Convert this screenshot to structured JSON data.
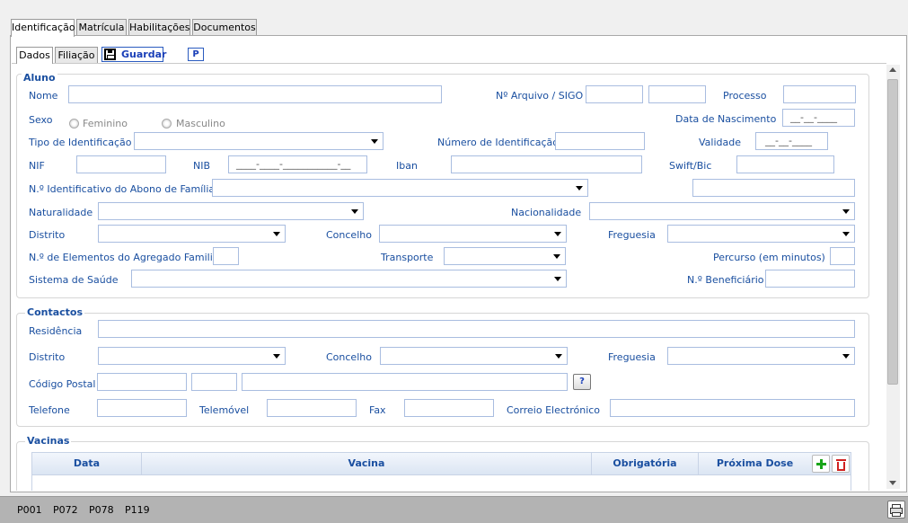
{
  "tabs": [
    "Identificação",
    "Matrícula",
    "Habilitações",
    "Documentos"
  ],
  "subtabs": [
    "Dados",
    "Filiação"
  ],
  "toolbar": {
    "save_label": "Guardar",
    "p_label": "P"
  },
  "aluno": {
    "legend": "Aluno",
    "nome": "Nome",
    "arquivo": "Nº Arquivo / SIGO",
    "processo": "Processo",
    "sexo": "Sexo",
    "feminino": "Feminino",
    "masculino": "Masculino",
    "data_nascimento": "Data de Nascimento",
    "data_nascimento_mask": "__-__-____",
    "tipo_identificacao": "Tipo de Identificação",
    "numero_identificacao": "Número de Identificação",
    "validade": "Validade",
    "validade_mask": "__-__-____",
    "nif": "NIF",
    "nib": "NIB",
    "nib_mask": "____-____-___________-__",
    "iban": "Iban",
    "swift": "Swift/Bic",
    "abono": "N.º Identificativo do Abono de Família",
    "naturalidade": "Naturalidade",
    "nacionalidade": "Nacionalidade",
    "distrito": "Distrito",
    "concelho": "Concelho",
    "freguesia": "Freguesia",
    "agregado": "N.º de Elementos do Agregado Familiar",
    "transporte": "Transporte",
    "percurso": "Percurso (em  minutos)",
    "saude": "Sistema de Saúde",
    "beneficiario": "N.º Beneficiário"
  },
  "contactos": {
    "legend": "Contactos",
    "residencia": "Residência",
    "distrito": "Distrito",
    "concelho": "Concelho",
    "freguesia": "Freguesia",
    "codigo_postal": "Código Postal",
    "help": "?",
    "telefone": "Telefone",
    "telemovel": "Telemóvel",
    "fax": "Fax",
    "correio": "Correio Electrónico"
  },
  "vacinas": {
    "legend": "Vacinas",
    "columns": [
      "Data",
      "Vacina",
      "Obrigatória",
      "Próxima Dose"
    ]
  },
  "status": {
    "codes": [
      "P001",
      "P072",
      "P078",
      "P119"
    ]
  }
}
